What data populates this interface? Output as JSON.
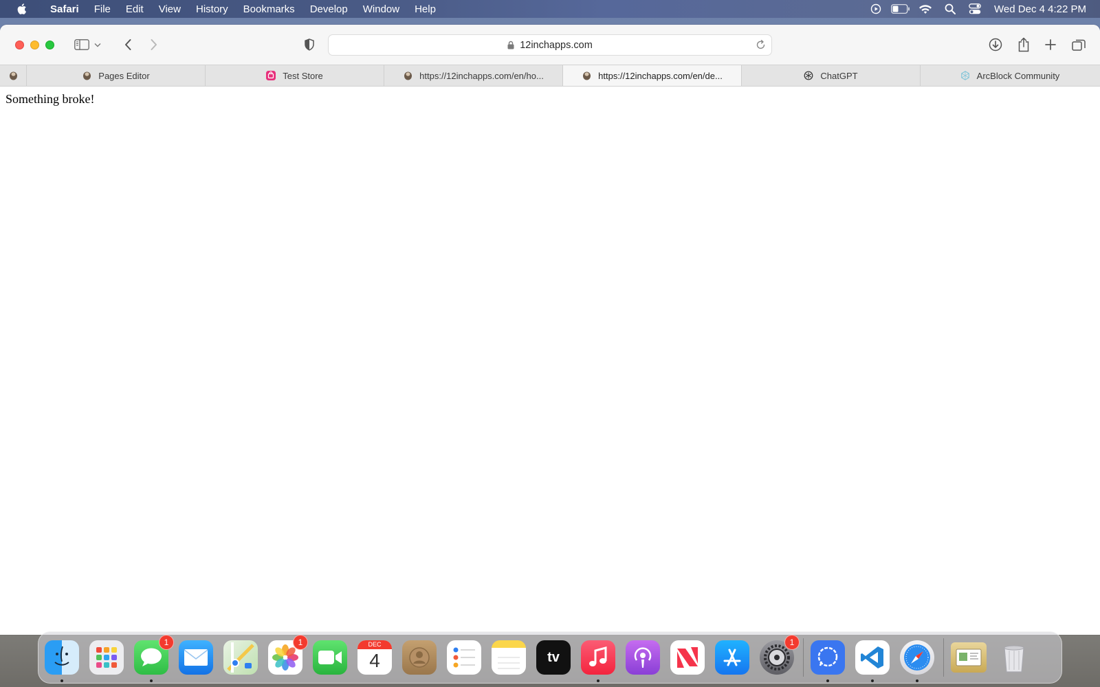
{
  "menubar": {
    "app_name": "Safari",
    "items": [
      "File",
      "Edit",
      "View",
      "History",
      "Bookmarks",
      "Develop",
      "Window",
      "Help"
    ],
    "clock": "Wed Dec 4  4:22 PM"
  },
  "browser": {
    "url": "12inchapps.com",
    "tabs": [
      {
        "label": "",
        "icon": "site-favicon"
      },
      {
        "label": "Pages Editor",
        "icon": "site-favicon"
      },
      {
        "label": "Test Store",
        "icon": "store-favicon"
      },
      {
        "label": "https://12inchapps.com/en/ho...",
        "icon": "site-favicon"
      },
      {
        "label": "https://12inchapps.com/en/de...",
        "icon": "site-favicon"
      },
      {
        "label": "ChatGPT",
        "icon": "chatgpt-favicon"
      },
      {
        "label": "ArcBlock Community",
        "icon": "arcblock-favicon"
      }
    ]
  },
  "page": {
    "message": "Something broke!"
  },
  "dock": {
    "apps": [
      {
        "name": "Finder",
        "badge": ""
      },
      {
        "name": "Launchpad",
        "badge": ""
      },
      {
        "name": "Messages",
        "badge": "1"
      },
      {
        "name": "Mail",
        "badge": ""
      },
      {
        "name": "Maps",
        "badge": ""
      },
      {
        "name": "Photos",
        "badge": "1"
      },
      {
        "name": "FaceTime",
        "badge": ""
      },
      {
        "name": "Calendar",
        "badge": "",
        "month": "DEC",
        "day": "4"
      },
      {
        "name": "Contacts",
        "badge": ""
      },
      {
        "name": "Reminders",
        "badge": ""
      },
      {
        "name": "Notes",
        "badge": ""
      },
      {
        "name": "TV",
        "badge": "",
        "label": "tv"
      },
      {
        "name": "Music",
        "badge": ""
      },
      {
        "name": "Podcasts",
        "badge": ""
      },
      {
        "name": "News",
        "badge": ""
      },
      {
        "name": "App Store",
        "badge": ""
      },
      {
        "name": "System Settings",
        "badge": "1"
      },
      {
        "name": "Signal",
        "badge": ""
      },
      {
        "name": "VS Code",
        "badge": ""
      },
      {
        "name": "Safari",
        "badge": ""
      },
      {
        "name": "Preview Folder",
        "badge": ""
      },
      {
        "name": "Trash",
        "badge": ""
      }
    ]
  },
  "colors": {
    "close": "#fe5f57",
    "minimize": "#febc2e",
    "maximize": "#28c840",
    "badge": "#f33a2e"
  }
}
